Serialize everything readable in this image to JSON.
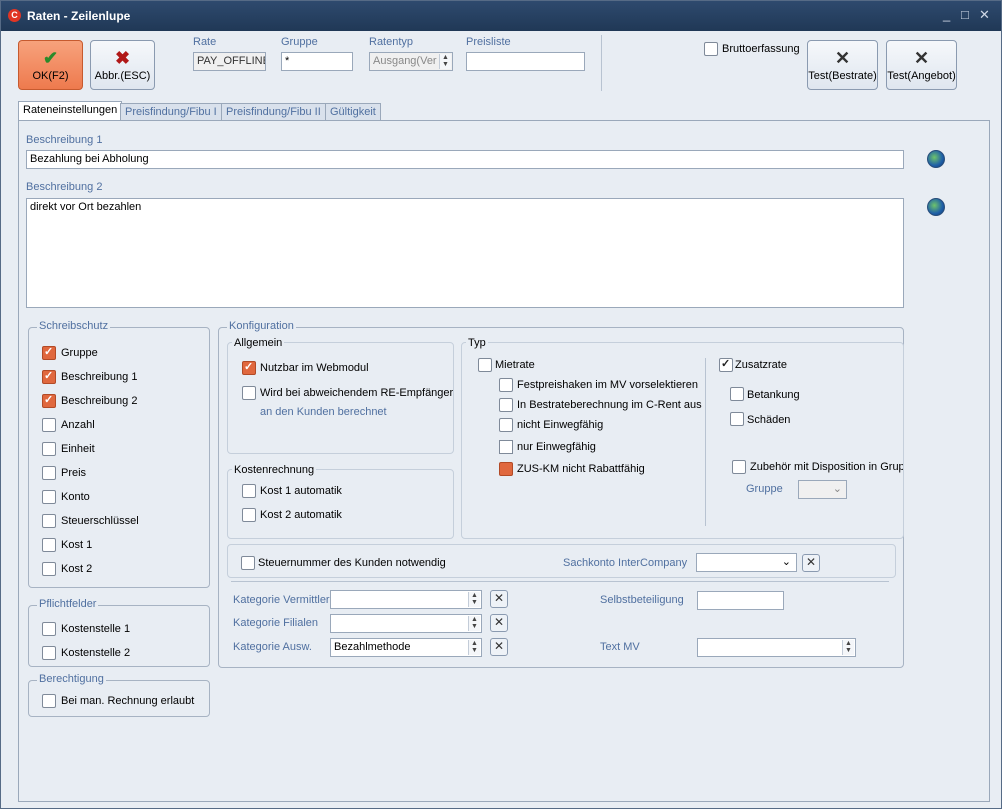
{
  "window": {
    "title": "Raten - Zeilenlupe",
    "minimize": "_",
    "restore": "□",
    "close": "✕"
  },
  "toolbar": {
    "ok_label": "OK(F2)",
    "cancel_label": "Abbr.(ESC)",
    "rate_label": "Rate",
    "rate_value": "PAY_OFFLINE",
    "gruppe_label": "Gruppe",
    "gruppe_value": "*",
    "ratentyp_label": "Ratentyp",
    "ratentyp_value": "Ausgang(Ver",
    "preisliste_label": "Preisliste",
    "preisliste_value": "",
    "brutto_label": "Bruttoerfassung",
    "test_bestrate_label": "Test(Bestrate)",
    "test_angebot_label": "Test(Angebot)"
  },
  "tabs": [
    "Rateneinstellungen",
    "Preisfindung/Fibu I",
    "Preisfindung/Fibu II",
    "Gültigkeit"
  ],
  "beschreibung1": {
    "label": "Beschreibung 1",
    "value": "Bezahlung bei Abholung"
  },
  "beschreibung2": {
    "label": "Beschreibung 2",
    "value": "direkt vor Ort bezahlen"
  },
  "schreibschutz": {
    "title": "Schreibschutz",
    "items": [
      {
        "label": "Gruppe",
        "checked": true
      },
      {
        "label": "Beschreibung 1",
        "checked": true
      },
      {
        "label": "Beschreibung 2",
        "checked": true
      },
      {
        "label": "Anzahl",
        "checked": false
      },
      {
        "label": "Einheit",
        "checked": false
      },
      {
        "label": "Preis",
        "checked": false
      },
      {
        "label": "Konto",
        "checked": false
      },
      {
        "label": "Steuerschlüssel",
        "checked": false
      },
      {
        "label": "Kost 1",
        "checked": false
      },
      {
        "label": "Kost 2",
        "checked": false
      }
    ]
  },
  "pflichtfelder": {
    "title": "Pflichtfelder",
    "items": [
      {
        "label": "Kostenstelle 1",
        "checked": false
      },
      {
        "label": "Kostenstelle 2",
        "checked": false
      }
    ]
  },
  "berechtigung": {
    "title": "Berechtigung",
    "items": [
      {
        "label": "Bei man. Rechnung erlaubt",
        "checked": false
      }
    ]
  },
  "konfiguration": {
    "title": "Konfiguration",
    "allgemein": {
      "title": "Allgemein",
      "webmodul": "Nutzbar im Webmodul",
      "re_empf_line1": "Wird bei abweichendem RE-Empfänger",
      "re_empf_line2": "an den Kunden berechnet"
    },
    "kostenrechnung": {
      "title": "Kostenrechnung",
      "kost1": "Kost 1 automatik",
      "kost2": "Kost 2 automatik"
    },
    "typ": {
      "title": "Typ",
      "mietrate": "Mietrate",
      "festpreis": "Festpreishaken im MV vorselektieren",
      "bestrate": "In Bestrateberechnung im C-Rent aus",
      "nicht_einweg": "nicht Einwegfähig",
      "nur_einweg": "nur Einwegfähig",
      "zus_km": "ZUS-KM nicht Rabattfähig",
      "zusatzrate": "Zusatzrate",
      "betankung": "Betankung",
      "schaeden": "Schäden",
      "zubehoer": "Zubehör mit Disposition in Gruppe",
      "gruppe_label": "Gruppe"
    },
    "steuernummer": "Steuernummer des Kunden notwendig",
    "sachkonto_label": "Sachkonto InterCompany",
    "kat_vermittler_label": "Kategorie Vermittler",
    "kat_filialen_label": "Kategorie Filialen",
    "kat_ausw_label": "Kategorie Ausw.",
    "kat_ausw_value": "Bezahlmethode",
    "selbstbeteiligung_label": "Selbstbeteiligung",
    "text_mv_label": "Text MV"
  },
  "colors": {
    "accent": "#e0683e",
    "title_bar": "#203856",
    "label_blue": "#5070a0"
  },
  "icons": {
    "ok": "check-icon",
    "cancel": "x-icon",
    "test": "tools-icon",
    "lang": "globe-icon"
  }
}
